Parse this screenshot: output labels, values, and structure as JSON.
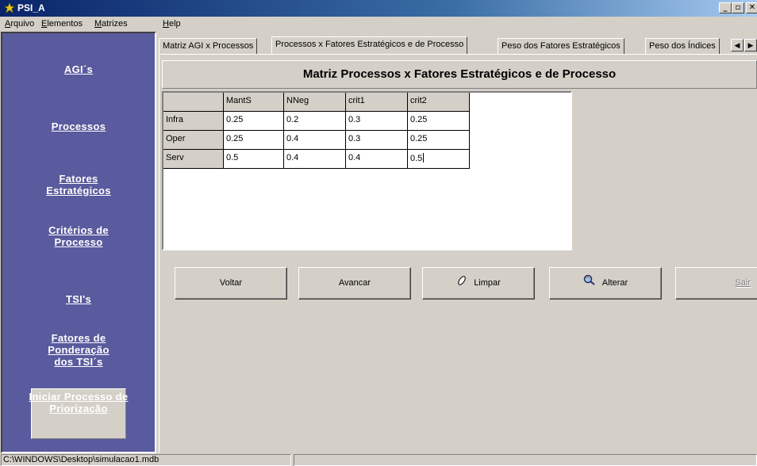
{
  "window": {
    "title": "PSI_A"
  },
  "menu": [
    "Arquivo",
    "Elementos",
    "Matrizes",
    "Help"
  ],
  "sidebar": {
    "items": [
      "AGI´s",
      "Processos",
      "Fatores Estratégicos",
      "Critérios de Processo",
      "TSI's",
      "Fatores de Ponderação dos TSI´s"
    ],
    "start_button": "Iniciar Processo de Priorização"
  },
  "tabs": [
    "Matriz AGI x Processos",
    "Processos x Fatores Estratégicos e de Processo",
    "Peso dos Fatores Estratégicos",
    "Peso dos Índices"
  ],
  "active_tab": 1,
  "matrix": {
    "title": "Matriz Processos x Fatores Estratégicos e de Processo",
    "columns": [
      "MantS",
      "NNeg",
      "crit1",
      "crit2"
    ],
    "rows": [
      {
        "label": "Infra",
        "values": [
          "0.25",
          "0.2",
          "0.3",
          "0.25"
        ]
      },
      {
        "label": "Oper",
        "values": [
          "0.25",
          "0.4",
          "0.3",
          "0.25"
        ]
      },
      {
        "label": "Serv",
        "values": [
          "0.5",
          "0.4",
          "0.4",
          "0.5"
        ]
      }
    ]
  },
  "buttons": {
    "back": "Voltar",
    "next": "Avancar",
    "clear": "Limpar",
    "edit": "Alterar",
    "exit": "Sair"
  },
  "status": {
    "path": "C:\\WINDOWS\\Desktop\\simulacao1.mdb",
    "secondary": ""
  }
}
